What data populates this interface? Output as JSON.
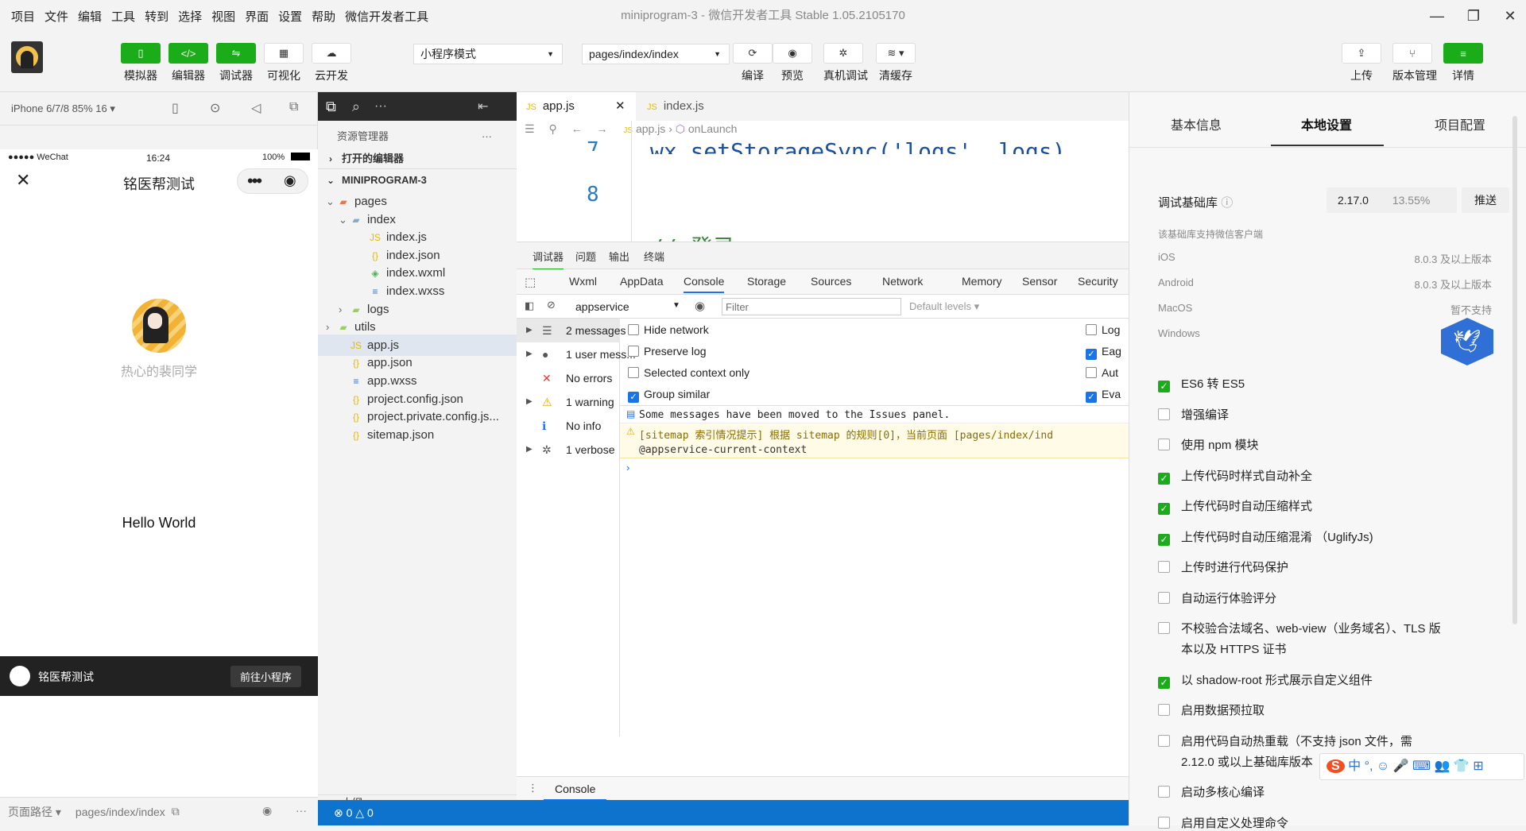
{
  "menus": [
    "项目",
    "文件",
    "编辑",
    "工具",
    "转到",
    "选择",
    "视图",
    "界面",
    "设置",
    "帮助",
    "微信开发者工具"
  ],
  "window_title": "miniprogram-3 - 微信开发者工具 Stable 1.05.2105170",
  "toolbar": {
    "simulator": "模拟器",
    "editor": "编辑器",
    "debugger": "调试器",
    "visual": "可视化",
    "cloud": "云开发",
    "mode": "小程序模式",
    "page": "pages/index/index",
    "compile": "编译",
    "preview": "预览",
    "remote_debug": "真机调试",
    "clear_cache": "清缓存",
    "upload": "上传",
    "version": "版本管理",
    "details": "详情"
  },
  "simulator": {
    "device": "iPhone 6/7/8 85% 16 ▾",
    "carrier": "●●●●● WeChat",
    "time": "16:24",
    "battery": "100%",
    "nav_title": "铭医帮测试",
    "nickname": "热心的裴同学",
    "hello": "Hello World",
    "toast_name": "铭医帮测试",
    "toast_button": "前往小程序",
    "path_label": "页面路径 ▾",
    "path_value": "pages/index/index"
  },
  "explorer": {
    "title": "资源管理器",
    "open_editors": "打开的编辑器",
    "project": "MINIPROGRAM-3",
    "outline": "大纲",
    "files": [
      {
        "label": "pages"
      },
      {
        "label": "index"
      },
      {
        "label": "index.js"
      },
      {
        "label": "index.json"
      },
      {
        "label": "index.wxml"
      },
      {
        "label": "index.wxss"
      },
      {
        "label": "logs"
      },
      {
        "label": "utils"
      },
      {
        "label": "app.js"
      },
      {
        "label": "app.json"
      },
      {
        "label": "app.wxss"
      },
      {
        "label": "project.config.json"
      },
      {
        "label": "project.private.config.js..."
      },
      {
        "label": "sitemap.json"
      }
    ]
  },
  "editor": {
    "tab1": "app.js",
    "tab2": "index.js",
    "crumb_file": "app.js",
    "crumb_fn": "onLaunch",
    "line7": "7",
    "line8": "8",
    "code7": "wx.setStorageSync('logs', logs)",
    "code9": "// 登录"
  },
  "devtools": {
    "top_tabs": [
      "调试器",
      "问题",
      "输出",
      "终端"
    ],
    "panels": [
      "Wxml",
      "AppData",
      "Console",
      "Storage",
      "Sources",
      "Network",
      "Memory",
      "Sensor",
      "Security"
    ],
    "context": "appservice",
    "filter_placeholder": "Filter",
    "levels": "Default levels ▾",
    "sidebar": [
      "2 messages",
      "1 user mess...",
      "No errors",
      "1 warning",
      "No info",
      "1 verbose"
    ],
    "options": [
      "Hide network",
      "Preserve log",
      "Selected context only",
      "Group similar"
    ],
    "options_right": [
      "Log",
      "Eag",
      "Aut",
      "Eva"
    ],
    "msg1": "Some messages have been moved to the Issues panel.",
    "msg2": "[sitemap 索引情况提示] 根据 sitemap 的规则[0]，当前页面 [pages/index/ind",
    "msg3": "@appservice-current-context",
    "drawer_tab": "Console",
    "status": "⊗ 0 △ 0"
  },
  "settings": {
    "tabs": [
      "基本信息",
      "本地设置",
      "项目配置"
    ],
    "lib_label": "调试基础库",
    "lib_version": "2.17.0",
    "lib_percent": "13.55%",
    "push": "推送",
    "support_note": "该基础库支持微信客户端",
    "platforms": [
      {
        "name": "iOS",
        "value": "8.0.3 及以上版本"
      },
      {
        "name": "Android",
        "value": "8.0.3 及以上版本"
      },
      {
        "name": "MacOS",
        "value": "暂不支持"
      },
      {
        "name": "Windows",
        "value": ""
      }
    ],
    "options": [
      {
        "label": "ES6 转 ES5",
        "checked": true
      },
      {
        "label": "增强编译",
        "checked": false
      },
      {
        "label": "使用 npm 模块",
        "checked": false
      },
      {
        "label": "上传代码时样式自动补全",
        "checked": true
      },
      {
        "label": "上传代码时自动压缩样式",
        "checked": true
      },
      {
        "label": "上传代码时自动压缩混淆 （UglifyJs)",
        "checked": true
      },
      {
        "label": "上传时进行代码保护",
        "checked": false
      },
      {
        "label": "自动运行体验评分",
        "checked": false
      },
      {
        "label": "不校验合法域名、web-view（业务域名）、TLS 版",
        "line2": "本以及 HTTPS 证书",
        "checked": false
      },
      {
        "label": "以 shadow-root 形式展示自定义组件",
        "checked": true
      },
      {
        "label": "启用数据预拉取",
        "checked": false
      },
      {
        "label": "启用代码自动热重载（不支持 json 文件，需",
        "line2": "2.12.0 或以上基础库版本",
        "checked": false
      },
      {
        "label": "启动多核心编译",
        "checked": false
      },
      {
        "label": "启用自定义处理命令",
        "checked": false
      }
    ]
  },
  "ime": "中 °, ☺ 🎤 ⌨ 👥 👕 ⊞"
}
